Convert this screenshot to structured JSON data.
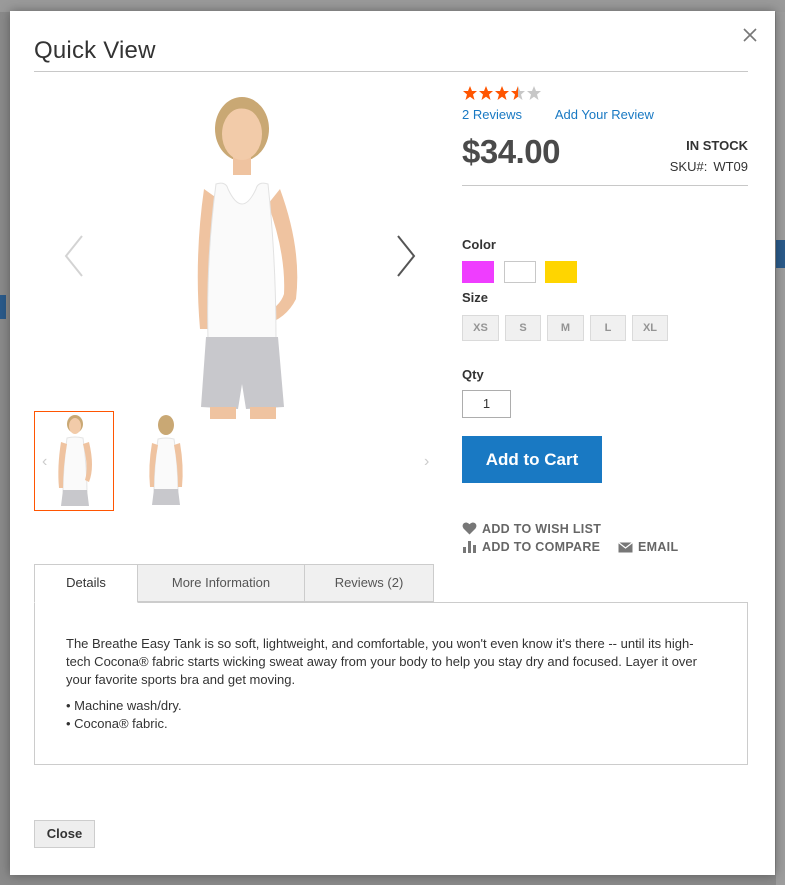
{
  "modal": {
    "title": "Quick View",
    "close_icon": "close-icon"
  },
  "gallery": {
    "main_image": "woman-white-tank-top-front",
    "thumbnails": [
      "woman-white-tank-top-front",
      "woman-white-tank-top-back"
    ],
    "prev_icon": "chevron-left-icon",
    "next_icon": "chevron-right-icon"
  },
  "product": {
    "rating": {
      "value": 3.5,
      "max": 5,
      "star_color": "#ff5501"
    },
    "reviews_link": "2 Reviews",
    "add_review_link": "Add Your Review",
    "price": "$34.00",
    "stock_status": "IN STOCK",
    "sku_label": "SKU#:",
    "sku_value": "WT09",
    "color_label": "Color",
    "colors": [
      {
        "name": "Purple",
        "hex": "#ef3dff"
      },
      {
        "name": "White",
        "hex": "#ffffff"
      },
      {
        "name": "Yellow",
        "hex": "#ffd500"
      }
    ],
    "size_label": "Size",
    "sizes": [
      "XS",
      "S",
      "M",
      "L",
      "XL"
    ],
    "qty_label": "Qty",
    "qty_value": "1",
    "add_to_cart": "Add to Cart",
    "actions": {
      "wishlist": "ADD TO WISH LIST",
      "compare": "ADD TO COMPARE",
      "email": "EMAIL"
    }
  },
  "tabs": {
    "items": [
      "Details",
      "More Information",
      "Reviews (2)"
    ],
    "active": "Details"
  },
  "details": {
    "description": "The Breathe Easy Tank is so soft, lightweight, and comfortable, you won't even know it's there -- until its high-tech Cocona® fabric starts wicking sweat away from your body to help you stay dry and focused. Layer it over your favorite sports bra and get moving.",
    "bullets": [
      "• Machine wash/dry.",
      "• Cocona® fabric."
    ]
  },
  "footer": {
    "close_button": "Close"
  },
  "colors": {
    "accent": "#1979c3",
    "active_thumb_border": "#ff5501"
  }
}
